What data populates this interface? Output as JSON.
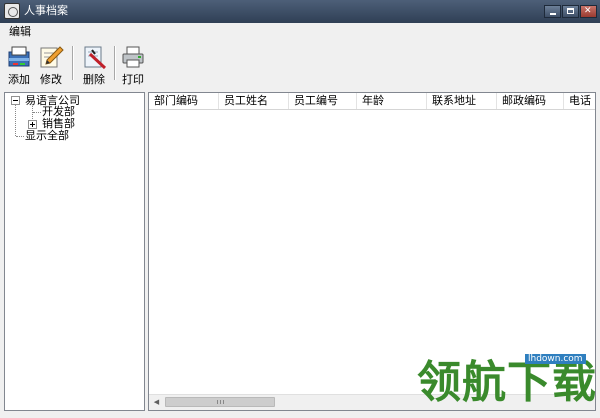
{
  "window": {
    "title": "人事档案"
  },
  "menu": {
    "items": [
      "编辑"
    ]
  },
  "toolbar": {
    "add": "添加",
    "edit": "修改",
    "delete": "删除",
    "print": "打印"
  },
  "tree": {
    "root": "易语言公司",
    "children": [
      "开发部",
      "销售部"
    ],
    "show_all": "显示全部"
  },
  "list": {
    "columns": [
      "部门编码",
      "员工姓名",
      "员工编号",
      "年龄",
      "联系地址",
      "邮政编码",
      "电话"
    ]
  },
  "scrollbar": {
    "grip": "III"
  },
  "watermark": {
    "text": "领航下载",
    "url": "lhdown.com"
  }
}
